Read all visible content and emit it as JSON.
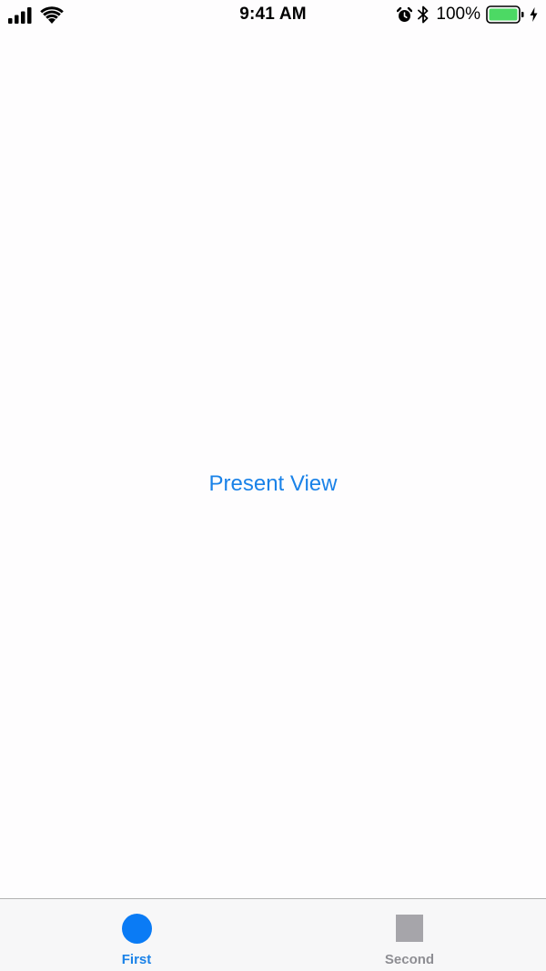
{
  "status_bar": {
    "time": "9:41 AM",
    "battery_percent": "100%",
    "icons": [
      "signal-icon",
      "wifi-icon",
      "alarm-icon",
      "bluetooth-icon",
      "battery-icon",
      "charge-icon"
    ],
    "battery_color": "#4cd964"
  },
  "main": {
    "present_button_label": "Present View",
    "accent_color": "#1a82e8"
  },
  "tab_bar": {
    "tabs": [
      {
        "label": "First",
        "icon": "circle-icon",
        "selected": true,
        "color": "#1a82e8"
      },
      {
        "label": "Second",
        "icon": "square-icon",
        "selected": false,
        "color": "#8e8e93"
      }
    ]
  }
}
